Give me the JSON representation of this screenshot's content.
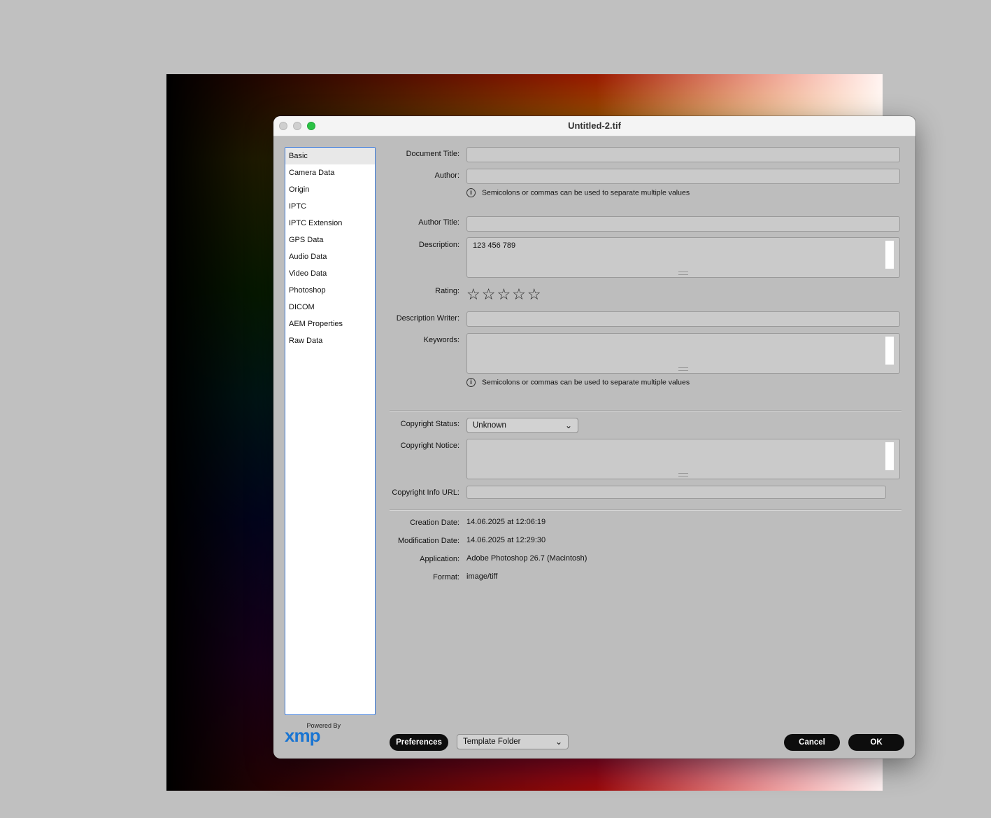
{
  "window": {
    "title": "Untitled-2.tif"
  },
  "sidebar": {
    "items": [
      {
        "label": "Basic",
        "active": true
      },
      {
        "label": "Camera Data"
      },
      {
        "label": "Origin"
      },
      {
        "label": "IPTC"
      },
      {
        "label": "IPTC Extension"
      },
      {
        "label": "GPS Data"
      },
      {
        "label": "Audio Data"
      },
      {
        "label": "Video Data"
      },
      {
        "label": "Photoshop"
      },
      {
        "label": "DICOM"
      },
      {
        "label": "AEM Properties"
      },
      {
        "label": "Raw Data"
      }
    ]
  },
  "branding": {
    "powered_by": "Powered By",
    "logo_text": "xmp"
  },
  "form": {
    "document_title": {
      "label": "Document Title:",
      "value": ""
    },
    "author": {
      "label": "Author:",
      "value": ""
    },
    "hint_text": "Semicolons or commas can be used to separate multiple values",
    "author_title": {
      "label": "Author Title:",
      "value": ""
    },
    "description": {
      "label": "Description:",
      "value": "123 456 789"
    },
    "rating": {
      "label": "Rating:",
      "value": 0,
      "max": 5,
      "star_glyphs": "☆☆☆☆☆"
    },
    "description_writer": {
      "label": "Description Writer:",
      "value": ""
    },
    "keywords": {
      "label": "Keywords:",
      "value": ""
    },
    "copyright_status": {
      "label": "Copyright Status:",
      "value": "Unknown"
    },
    "copyright_notice": {
      "label": "Copyright Notice:",
      "value": ""
    },
    "copyright_url": {
      "label": "Copyright Info URL:",
      "value": ""
    }
  },
  "info": {
    "creation_date": {
      "label": "Creation Date:",
      "value": "14.06.2025 at 12:06:19"
    },
    "modification_date": {
      "label": "Modification Date:",
      "value": "14.06.2025 at 12:29:30"
    },
    "application": {
      "label": "Application:",
      "value": "Adobe Photoshop 26.7 (Macintosh)"
    },
    "format": {
      "label": "Format:",
      "value": "image/tiff"
    }
  },
  "footer": {
    "preferences_label": "Preferences",
    "template_folder": "Template Folder",
    "cancel_label": "Cancel",
    "ok_label": "OK"
  },
  "icons": {
    "info": "info-icon",
    "chevron": "chevron-down-icon",
    "star": "star-icon"
  },
  "colors": {
    "accent": "#3b7ad9",
    "xmp_blue": "#1a75d2",
    "button_dark": "#0d0d0d",
    "close_green": "#2bc245"
  }
}
